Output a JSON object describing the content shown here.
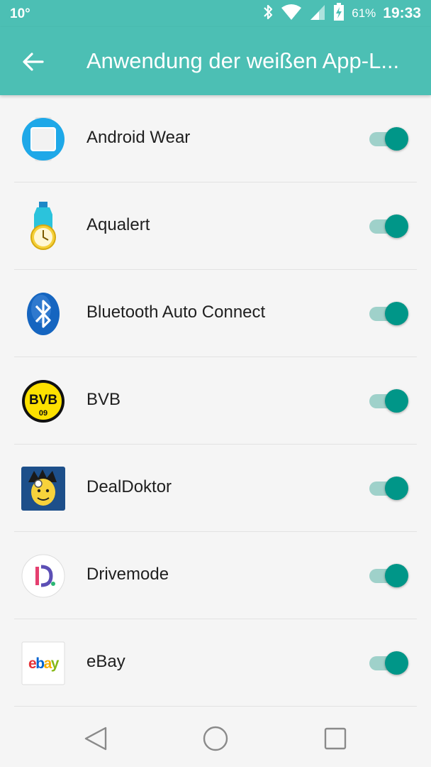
{
  "status_bar": {
    "temperature": "10°",
    "battery": "61%",
    "time": "19:33",
    "icons": [
      "bluetooth-icon",
      "wifi-icon",
      "cell-signal-icon",
      "battery-charging-icon"
    ]
  },
  "app_bar": {
    "title": "Anwendung der weißen App-L...",
    "back_icon": "arrow-left-icon",
    "background": "#4cbfb4"
  },
  "apps": [
    {
      "label": "Android Wear",
      "icon": "android-wear-icon",
      "enabled": true
    },
    {
      "label": "Aqualert",
      "icon": "aqualert-icon",
      "enabled": true
    },
    {
      "label": "Bluetooth Auto Connect",
      "icon": "bluetooth-auto-connect-icon",
      "enabled": true
    },
    {
      "label": "BVB",
      "icon": "bvb-icon",
      "enabled": true
    },
    {
      "label": "DealDoktor",
      "icon": "dealdoktor-icon",
      "enabled": true
    },
    {
      "label": "Drivemode",
      "icon": "drivemode-icon",
      "enabled": true
    },
    {
      "label": "eBay",
      "icon": "ebay-icon",
      "enabled": true
    }
  ],
  "bvb_logo": {
    "text": "BVB",
    "year": "09"
  },
  "ebay_logo": {
    "letters": [
      "e",
      "b",
      "a",
      "y"
    ],
    "colors": [
      "#e53238",
      "#0064d2",
      "#f5af02",
      "#86b817"
    ]
  },
  "navigation_bar": {
    "icons": [
      "back-triangle-icon",
      "home-circle-icon",
      "recents-square-icon"
    ]
  },
  "colors": {
    "accent": "#009688",
    "switch_track": "#9fd1ca"
  }
}
